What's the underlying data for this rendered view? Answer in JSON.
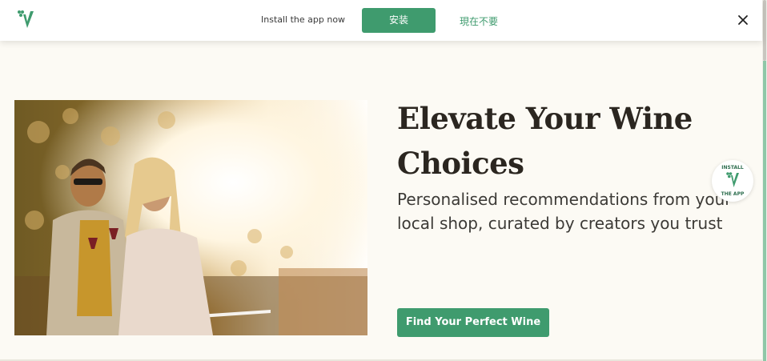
{
  "banner": {
    "prompt": "Install the app now",
    "install_label": "安装",
    "not_now_label": "現在不要"
  },
  "hero": {
    "headline_line1": "Elevate Your Wine",
    "headline_line2": "Choices",
    "subhead": "Personalised recommendations from your local shop, curated by creators you trust",
    "cta_label": "Find Your Perfect Wine"
  },
  "badge": {
    "top_text": "INSTALL",
    "bottom_text": "THE APP"
  },
  "icons": {
    "logo": "grape-v-logo-icon",
    "close": "close-icon"
  },
  "colors": {
    "brand_green": "#3f9b6e",
    "headline": "#2b2620",
    "background": "#fcfaf4"
  }
}
